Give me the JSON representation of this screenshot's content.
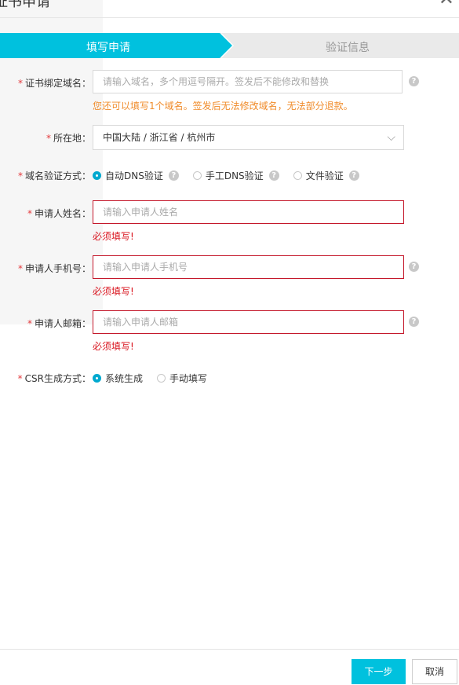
{
  "dialog": {
    "title": "证书申请",
    "close_label": "✕"
  },
  "steps": [
    {
      "label": "填写申请",
      "active": true
    },
    {
      "label": "验证信息",
      "active": false
    }
  ],
  "form": {
    "domain": {
      "label": "证书绑定域名：",
      "placeholder": "请输入域名，多个用逗号隔开。签发后不能修改和替换",
      "hint": "您还可以填写1个域名。签发后无法修改域名，无法部分退款。"
    },
    "location": {
      "label": "所在地：",
      "value": "中国大陆 / 浙江省 / 杭州市"
    },
    "verify": {
      "label": "域名验证方式：",
      "options": [
        {
          "label": "自动DNS验证",
          "selected": true
        },
        {
          "label": "手工DNS验证",
          "selected": false
        },
        {
          "label": "文件验证",
          "selected": false
        }
      ]
    },
    "name": {
      "label": "申请人姓名：",
      "placeholder": "请输入申请人姓名",
      "error": "必须填写!"
    },
    "phone": {
      "label": "申请人手机号：",
      "placeholder": "请输入申请人手机号",
      "error": "必须填写!"
    },
    "email": {
      "label": "申请人邮箱：",
      "placeholder": "请输入申请人邮箱",
      "error": "必须填写!"
    },
    "csr": {
      "label": "CSR生成方式：",
      "options": [
        {
          "label": "系统生成",
          "selected": true
        },
        {
          "label": "手动填写",
          "selected": false
        }
      ]
    },
    "required_mark": "*"
  },
  "footer": {
    "next_label": "下一步",
    "cancel_label": "取消"
  },
  "colors": {
    "accent": "#00c1de",
    "error": "#d9141e",
    "warning": "#f08c2b"
  }
}
